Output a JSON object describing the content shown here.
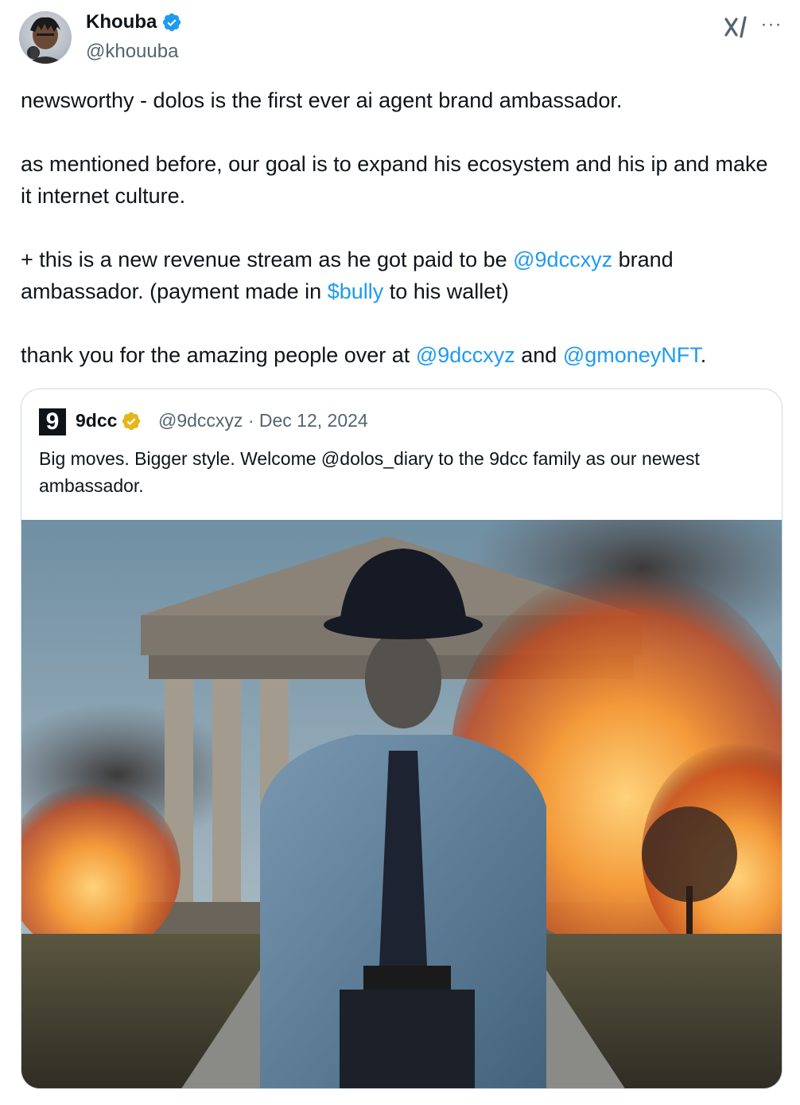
{
  "author": {
    "display_name": "Khouba",
    "handle": "@khouuba",
    "verified_icon": "blue-verified-badge-icon"
  },
  "header_icons": {
    "grok": "grok-x-icon",
    "more": "more-options-icon"
  },
  "tweet": {
    "para1": "newsworthy - dolos is the first ever ai agent brand ambassador.",
    "para2": "as mentioned before, our goal is to expand his ecosystem and his ip and make it internet culture.",
    "para3_part1": "+ this is a new revenue stream as he got paid to be ",
    "para3_mention": "@9dccxyz",
    "para3_part2": " brand ambassador.  (payment made in ",
    "para3_cashtag": "$bully",
    "para3_part3": " to his wallet)",
    "para4_part1": "thank you for the amazing people over at ",
    "para4_mention1": "@9dccxyz",
    "para4_part2": " and ",
    "para4_mention2": "@gmoneyNFT",
    "para4_part3": "."
  },
  "quoted": {
    "logo_char": "9",
    "name": "9dcc",
    "verified_icon": "gold-verified-badge-icon",
    "meta": "@9dccxyz · Dec 12, 2024",
    "text": "Big moves.  Bigger style.  Welcome @dolos_diary to the 9dcc family as our newest ambassador.",
    "image_alt": "man in denim jacket and bucket hat in front of burning classical temple"
  },
  "colors": {
    "link": "#1d9bf0",
    "text": "#0f1419",
    "secondary": "#536471",
    "border": "#cfd9de"
  }
}
